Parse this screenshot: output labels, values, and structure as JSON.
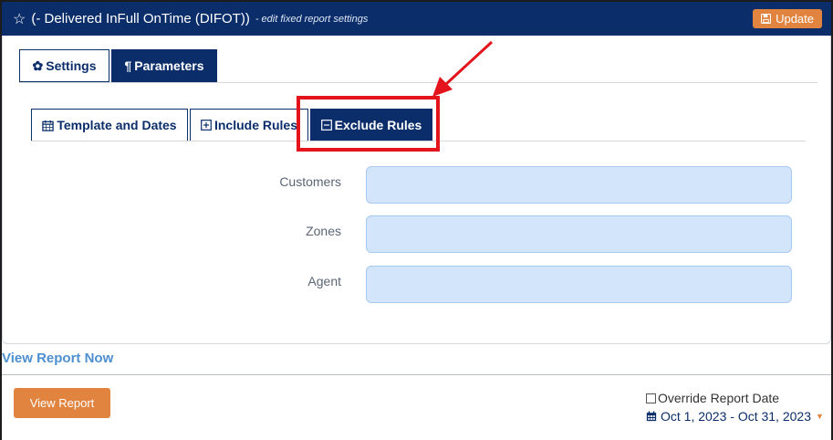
{
  "header": {
    "title": "(- Delivered InFull OnTime (DIFOT))",
    "subtitle": "- edit fixed report settings",
    "update_label": "Update"
  },
  "tabs_main": [
    {
      "label": "Settings",
      "icon": "gear-icon",
      "active": false
    },
    {
      "label": "Parameters",
      "icon": "pilcrow-icon",
      "active": true
    }
  ],
  "tabs_sub": [
    {
      "label": "Template and Dates",
      "icon": "calendar-icon",
      "active": false
    },
    {
      "label": "Include Rules",
      "icon": "plus-square-icon",
      "active": false
    },
    {
      "label": "Exclude Rules",
      "icon": "minus-square-icon",
      "active": true
    }
  ],
  "fields": [
    {
      "label": "Customers",
      "value": ""
    },
    {
      "label": "Zones",
      "value": ""
    },
    {
      "label": "Agent",
      "value": ""
    }
  ],
  "view_report_now": "View Report Now",
  "footer": {
    "view_report_label": "View Report",
    "override_label": "Override Report Date",
    "date_range": "Oct 1, 2023 - Oct 31, 2023"
  },
  "colors": {
    "brand_navy": "#0b2e6b",
    "accent_orange": "#e0843f",
    "input_bg": "#d3e5fa",
    "annotation_red": "#e3141b"
  }
}
